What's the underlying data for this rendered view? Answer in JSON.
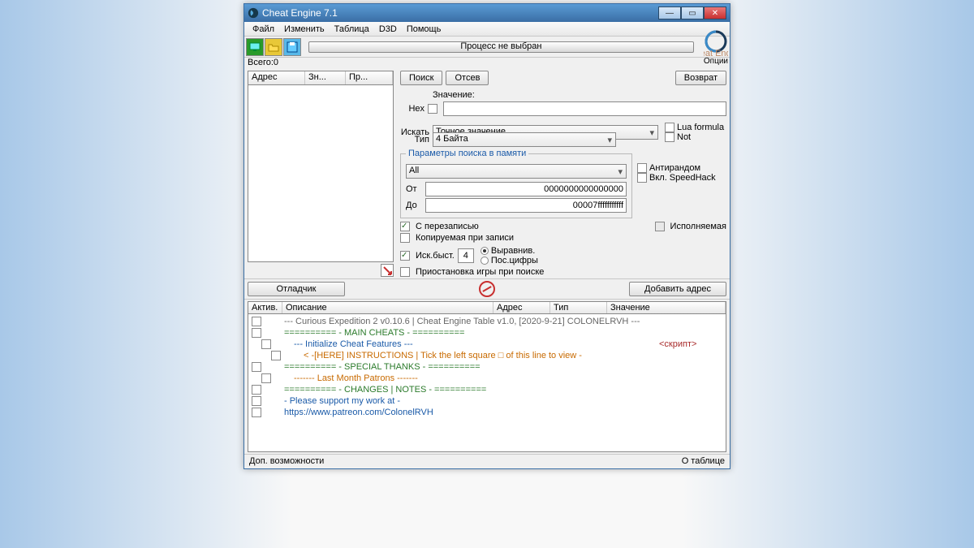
{
  "title": "Cheat Engine 7.1",
  "menu": {
    "file": "Файл",
    "edit": "Изменить",
    "table": "Таблица",
    "d3d": "D3D",
    "help": "Помощь"
  },
  "progress_text": "Процесс не выбран",
  "options_label": "Опции",
  "total_label": "Всего:",
  "total_value": "0",
  "left_cols": {
    "addr": "Адрес",
    "val": "Зн...",
    "prev": "Пр..."
  },
  "buttons": {
    "search": "Поиск",
    "filter": "Отсев",
    "revert": "Возврат",
    "debugger": "Отладчик",
    "addaddr": "Добавить адрес"
  },
  "labels": {
    "value": "Значение:",
    "hex": "Hex",
    "search_for": "Искать",
    "type": "Тип",
    "lua": "Lua formula",
    "not": "Not",
    "group": "Параметры поиска в памяти",
    "all": "All",
    "from": "От",
    "to": "До",
    "from_val": "0000000000000000",
    "to_val": "00007fffffffffff",
    "writable": "С перезаписью",
    "executable": "Исполняемая",
    "cow": "Копируемая при записи",
    "fastscan": "Иск.быст.",
    "fast_val": "4",
    "align": "Выравнив.",
    "lastdigits": "Пос.цифры",
    "pause": "Приостановка игры при поиске",
    "antirandom": "Антирандом",
    "speedhack": "Вкл. SpeedHack"
  },
  "selects": {
    "scantype": "Точное значение",
    "valtype": "4 Байта"
  },
  "table_cols": {
    "active": "Актив.",
    "desc": "Описание",
    "addr": "Адрес",
    "type": "Тип",
    "value": "Значение"
  },
  "rows": [
    {
      "indent": 0,
      "chk": true,
      "class": "txt-gray",
      "text": "--- Curious Expedition 2 v0.10.6 | Cheat Engine Table v1.0, [2020-9-21] COLONELRVH ---"
    },
    {
      "indent": 0,
      "chk": true,
      "class": "txt-green",
      "text": "========== - MAIN CHEATS -            =========="
    },
    {
      "indent": 1,
      "chk": true,
      "class": "txt-blue",
      "text": "--- Initialize Cheat Features ---",
      "value": "<скрипт>",
      "vclass": "txt-red"
    },
    {
      "indent": 2,
      "chk": true,
      "class": "txt-orange",
      "text": "< -[HERE] INSTRUCTIONS | Tick the left square □ of this line to view -"
    },
    {
      "indent": 0,
      "chk": true,
      "class": "txt-green",
      "text": "========== - SPECIAL THANKS -         =========="
    },
    {
      "indent": 1,
      "chk": true,
      "class": "txt-orange",
      "text": "-------          Last Month Patrons          -------"
    },
    {
      "indent": 0,
      "chk": true,
      "class": "txt-green",
      "text": "========== - CHANGES | NOTES -        =========="
    },
    {
      "indent": 0,
      "chk": true,
      "class": "txt-blue",
      "text": "- Please support my work at -"
    },
    {
      "indent": 0,
      "chk": true,
      "class": "txt-blue",
      "text": "https://www.patreon.com/ColonelRVH"
    }
  ],
  "status": {
    "left": "Доп. возможности",
    "right": "О таблице"
  }
}
